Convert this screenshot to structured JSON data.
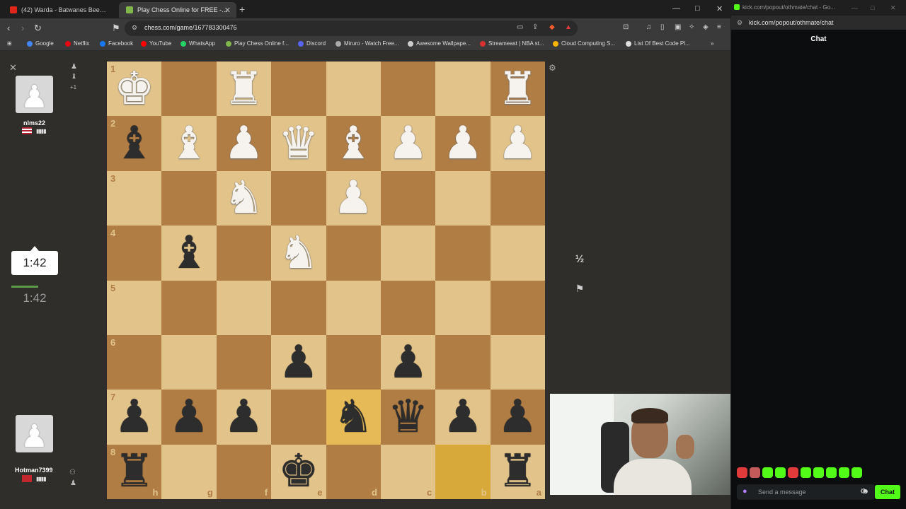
{
  "browser": {
    "tabs": [
      {
        "title": "(42) Warda - Batwanes Beek | ...",
        "favicon_color": "#e0261b"
      },
      {
        "title": "Play Chess Online for FREE - 2 P...",
        "favicon_color": "#81b64c"
      }
    ],
    "url": "chess.com/game/167783300476",
    "bookmarks": [
      {
        "label": "Google",
        "color": "#4285f4"
      },
      {
        "label": "Netflix",
        "color": "#e50914"
      },
      {
        "label": "Facebook",
        "color": "#1877f2"
      },
      {
        "label": "YouTube",
        "color": "#ff0000"
      },
      {
        "label": "WhatsApp",
        "color": "#25d366"
      },
      {
        "label": "Play Chess Online f...",
        "color": "#81b64c"
      },
      {
        "label": "Discord",
        "color": "#5865f2"
      },
      {
        "label": "Miruro - Watch Free...",
        "color": "#aaaaaa"
      },
      {
        "label": "Awesome Wallpape...",
        "color": "#cccccc"
      },
      {
        "label": "Streameast | NBA st...",
        "color": "#d83131"
      },
      {
        "label": "Cloud Computing S...",
        "color": "#f4b400"
      },
      {
        "label": "List Of Best Code Pl...",
        "color": "#dddddd"
      }
    ]
  },
  "game": {
    "board": {
      "ranks": [
        "1",
        "2",
        "3",
        "4",
        "5",
        "6",
        "7",
        "8"
      ],
      "files": [
        "h",
        "g",
        "f",
        "e",
        "d",
        "c",
        "b",
        "a"
      ],
      "pieces": [
        [
          "wK",
          "",
          "wR",
          "",
          "",
          "",
          "",
          "wR"
        ],
        [
          "bB",
          "wB",
          "wP",
          "wQ",
          "wB",
          "wP",
          "wP",
          "wP"
        ],
        [
          "",
          "",
          "wN",
          "",
          "wP",
          "",
          "",
          ""
        ],
        [
          "",
          "bB",
          "",
          "wN",
          "",
          "",
          "",
          ""
        ],
        [
          "",
          "",
          "",
          "",
          "",
          "",
          "",
          ""
        ],
        [
          "",
          "",
          "",
          "bP",
          "",
          "bP",
          "",
          ""
        ],
        [
          "bP",
          "bP",
          "bP",
          "",
          "bN",
          "bQ",
          "bP",
          "bP"
        ],
        [
          "bR",
          "",
          "",
          "bK",
          "",
          "",
          "",
          "bR"
        ]
      ],
      "highlighted": [
        [
          6,
          4
        ],
        [
          7,
          6
        ]
      ]
    },
    "top_player": {
      "name": "nlms22",
      "rating_bars": "▮▮▮▮",
      "clock": "1:42"
    },
    "bottom_player": {
      "name": "Hotman7399",
      "rating_bars": "▮▮▮▮",
      "clock": "1:42"
    },
    "draw_label": "½"
  },
  "chat_window": {
    "title": "kick.com/popout/othmate/chat - Go...",
    "url": "kick.com/popout/othmate/chat",
    "header": "Chat",
    "input_placeholder": "Send a message",
    "send_label": "Chat",
    "emote_colors": [
      "#e03a3a",
      "#c45a5a",
      "#53fc18",
      "#53fc18",
      "#e03a3a",
      "#53fc18",
      "#53fc18",
      "#53fc18",
      "#53fc18",
      "#53fc18"
    ]
  }
}
